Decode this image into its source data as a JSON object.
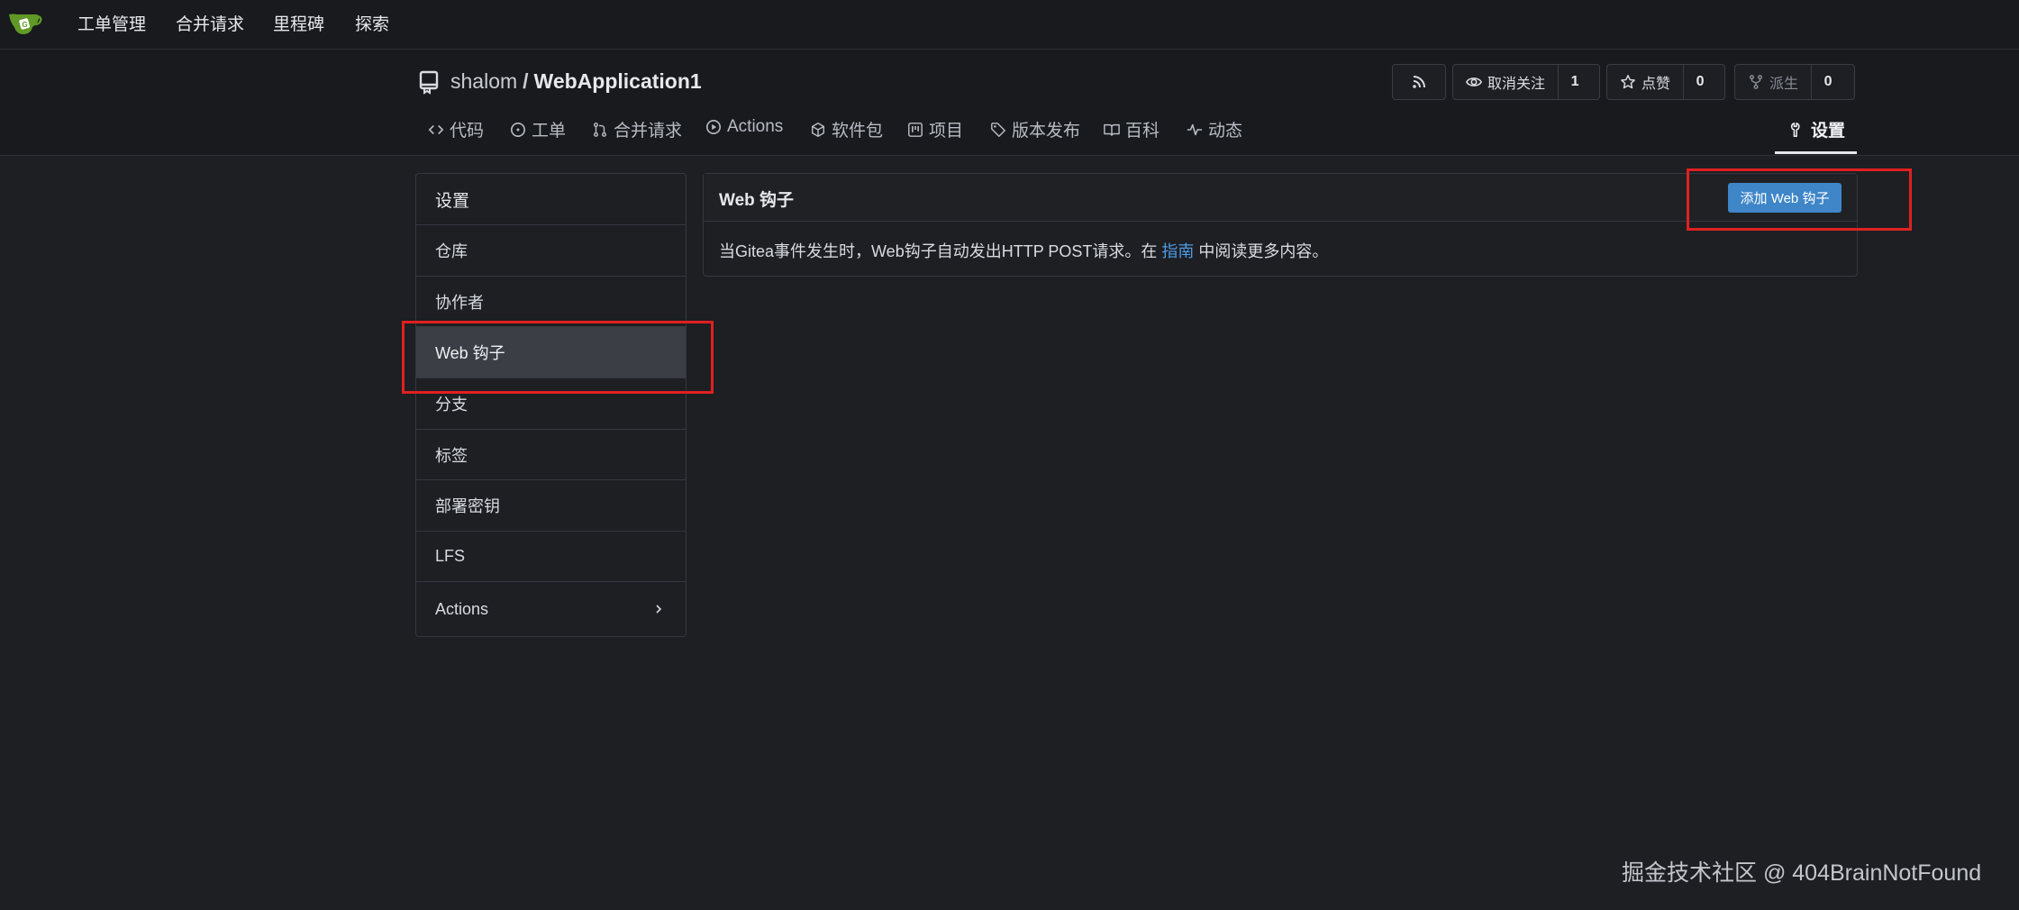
{
  "topnav": {
    "items": [
      "工单管理",
      "合并请求",
      "里程碑",
      "探索"
    ]
  },
  "repo": {
    "owner": "shalom",
    "separator": "/",
    "name": "WebApplication1",
    "watch": {
      "label": "取消关注",
      "count": "1"
    },
    "star": {
      "label": "点赞",
      "count": "0"
    },
    "fork": {
      "label": "派生",
      "count": "0"
    }
  },
  "tabs": {
    "code": "代码",
    "issues": "工单",
    "pulls": "合并请求",
    "actions": "Actions",
    "packages": "软件包",
    "projects": "项目",
    "releases": "版本发布",
    "wiki": "百科",
    "activity": "动态",
    "settings": "设置"
  },
  "sidebar": {
    "items": [
      "设置",
      "仓库",
      "协作者",
      "Web 钩子",
      "分支",
      "标签",
      "部署密钥",
      "LFS",
      "Actions"
    ],
    "active_index": 3
  },
  "webhooks": {
    "title": "Web 钩子",
    "add_button": "添加 Web 钩子",
    "desc_before": "当Gitea事件发生时，Web钩子自动发出HTTP POST请求。在 ",
    "desc_link": "指南",
    "desc_after": " 中阅读更多内容。"
  },
  "watermark": "掘金技术社区 @ 404BrainNotFound",
  "colors": {
    "accent_button": "#3f86c8",
    "link": "#4f9be4",
    "highlight_box": "#e02020",
    "background": "#1d1f23"
  }
}
